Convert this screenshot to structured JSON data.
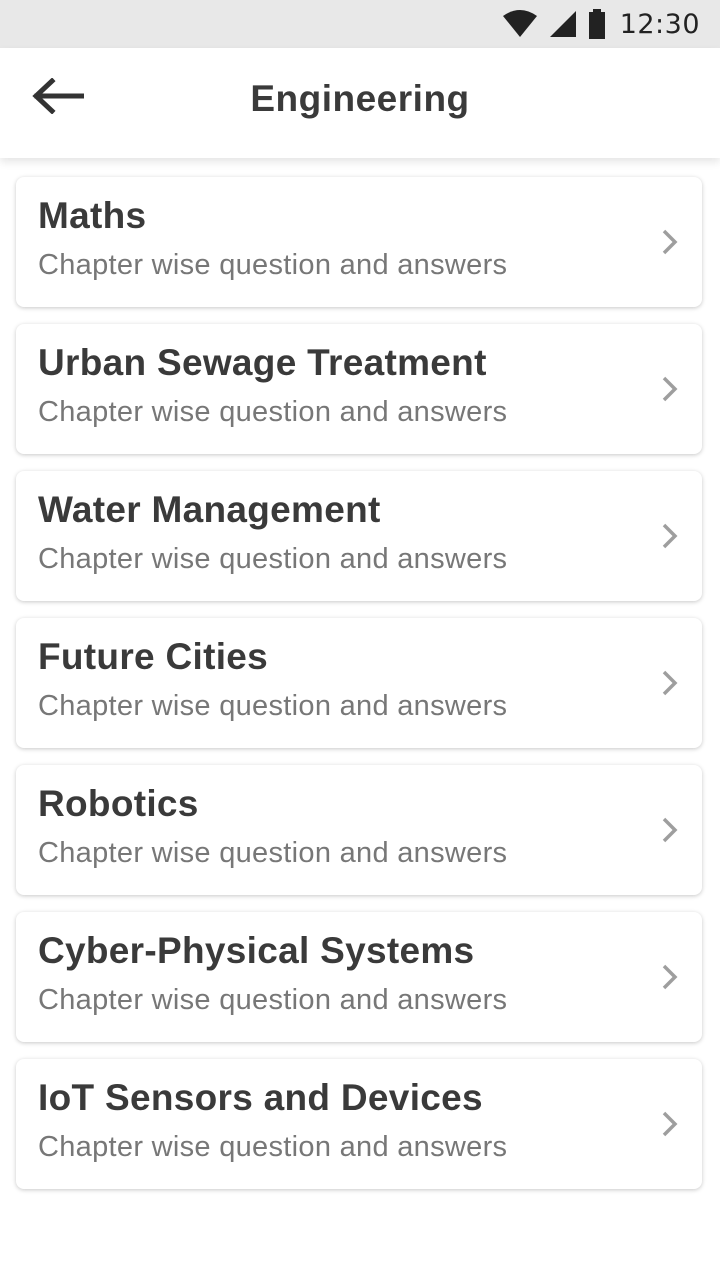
{
  "status_bar": {
    "time": "12:30",
    "icons": [
      "wifi-icon",
      "signal-icon",
      "battery-icon"
    ]
  },
  "header": {
    "title": "Engineering",
    "back_icon": "arrow-left-icon"
  },
  "subjects": [
    {
      "title": "Maths",
      "subtitle": "Chapter wise question and answers"
    },
    {
      "title": "Urban Sewage Treatment",
      "subtitle": "Chapter wise question and answers"
    },
    {
      "title": "Water Management",
      "subtitle": "Chapter wise question and answers"
    },
    {
      "title": "Future Cities",
      "subtitle": "Chapter wise question and answers"
    },
    {
      "title": "Robotics",
      "subtitle": "Chapter wise question and answers"
    },
    {
      "title": "Cyber-Physical Systems",
      "subtitle": "Chapter wise question and answers"
    },
    {
      "title": "IoT Sensors and Devices",
      "subtitle": "Chapter wise question and answers"
    }
  ],
  "colors": {
    "status_bar_bg": "#e8e8e8",
    "title_text": "#3a3a3a",
    "subtitle_text": "#777777",
    "chevron": "#9e9e9e"
  }
}
